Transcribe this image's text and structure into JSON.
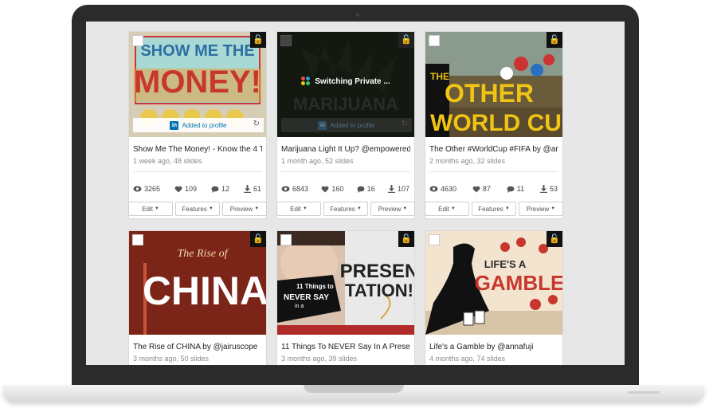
{
  "cards": [
    {
      "title": "Show Me The Money! - Know the 4 T...",
      "meta": "1 week ago, 48 slides",
      "thumb_text": [
        "SHOW ME THE",
        "MONEY!"
      ],
      "overlay_text": "Added to profile",
      "stats": {
        "views": "3265",
        "likes": "109",
        "comments": "12",
        "downloads": "61"
      },
      "buttons": [
        "Edit",
        "Features",
        "Preview"
      ]
    },
    {
      "title": "Marijuana Light It Up? @empowered...",
      "meta": "1 month ago, 52 slides",
      "thumb_text": [
        "MARIJUANA"
      ],
      "switching_text": "Switching Private ...",
      "overlay_text": "Added to profile",
      "stats": {
        "views": "6843",
        "likes": "160",
        "comments": "16",
        "downloads": "107"
      },
      "buttons": [
        "Edit",
        "Features",
        "Preview"
      ]
    },
    {
      "title": "The Other #WorldCup #FIFA by @an...",
      "meta": "2 months ago, 32 slides",
      "thumb_text": [
        "THE",
        "OTHER",
        "WORLD CUP"
      ],
      "stats": {
        "views": "4630",
        "likes": "87",
        "comments": "11",
        "downloads": "53"
      },
      "buttons": [
        "Edit",
        "Features",
        "Preview"
      ]
    },
    {
      "title": "The Rise of CHINA by @jairuscope",
      "meta": "3 months ago, 50 slides",
      "thumb_text": [
        "The Rise of",
        "CHINA"
      ]
    },
    {
      "title": "11 Things To NEVER Say In A Prese...",
      "meta": "3 months ago, 39 slides",
      "thumb_text": [
        "11 Things to",
        "NEVER SAY",
        "in a",
        "PRESEN",
        "TATION!"
      ]
    },
    {
      "title": "Life's a Gamble by @annafuji",
      "meta": "4 months ago, 74 slides",
      "thumb_text": [
        "LIFE'S A",
        "GAMBLE"
      ]
    }
  ],
  "icons": {
    "lock": "unlock-icon",
    "views": "eye-icon",
    "likes": "heart-icon",
    "comments": "comment-icon",
    "downloads": "download-icon"
  },
  "colors": {
    "linkedin": "#0073b1",
    "screen_bg": "#e7e7e7",
    "bezel": "#2b2b2b"
  }
}
